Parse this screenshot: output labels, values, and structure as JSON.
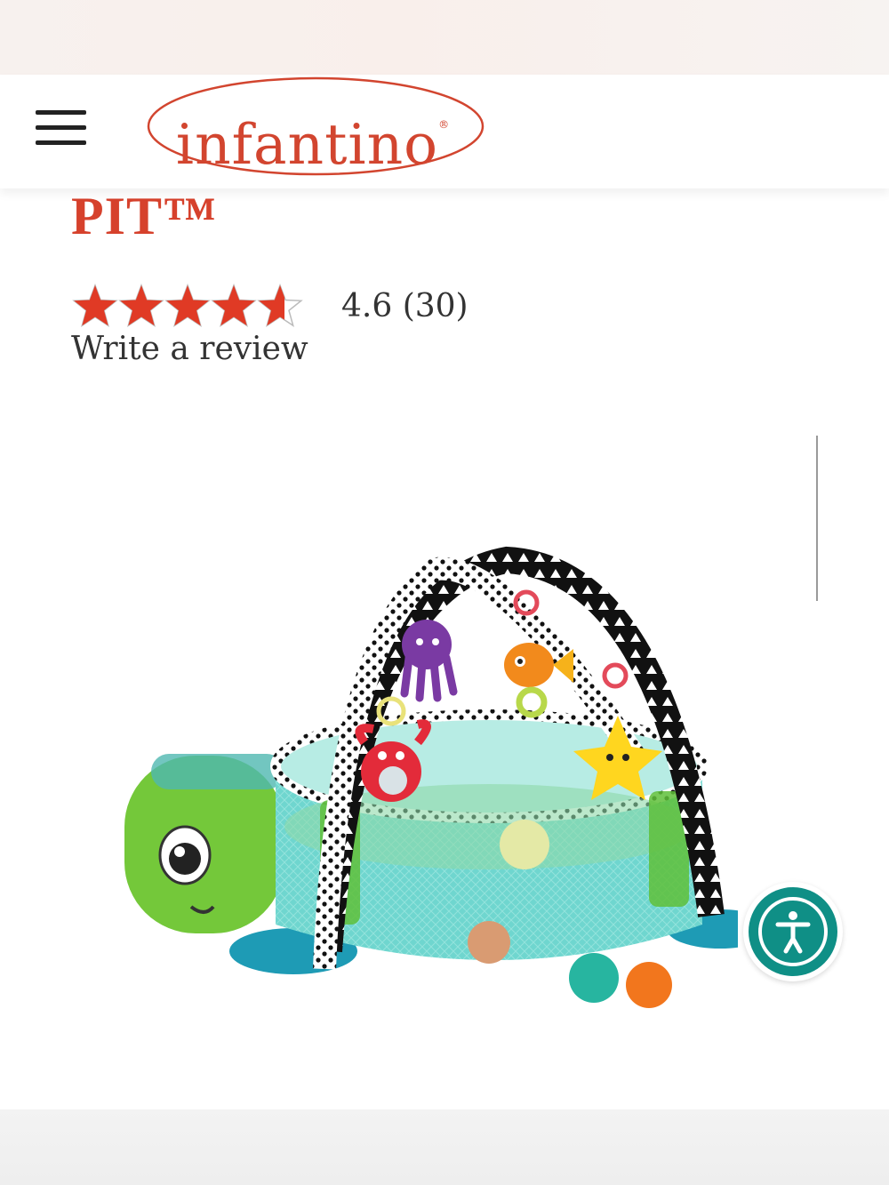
{
  "header": {
    "menu_icon": "hamburger-menu-icon",
    "logo_text": "infantino",
    "logo_mark": "®",
    "brand_color": "#d2452f"
  },
  "product": {
    "title_fragment": "PIT™",
    "rating": {
      "stars": 4.6,
      "max_stars": 5,
      "value_text": "4.6 (30)",
      "write_review": "Write a review",
      "star_color": "#e03a25"
    },
    "image_icon": "turtle-activity-gym-ball-pit-image"
  },
  "accessibility": {
    "icon": "accessibility-person-icon",
    "color": "#0f8f86"
  }
}
